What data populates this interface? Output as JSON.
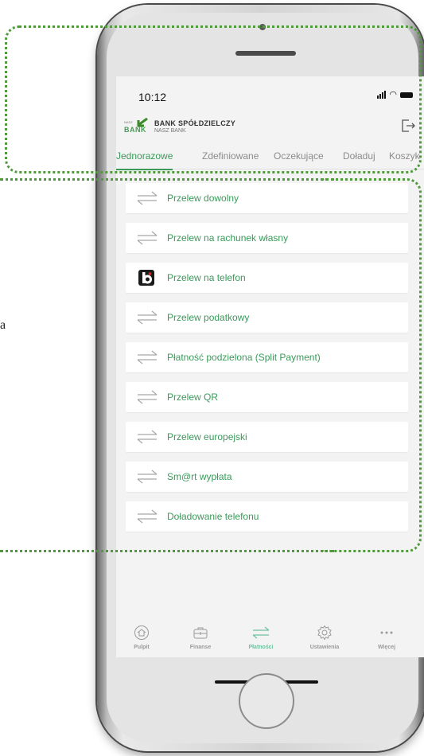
{
  "status": {
    "time": "10:12"
  },
  "brand": {
    "logo_small": "NASZ",
    "logo_word": "BANK",
    "name": "BANK SPÓŁDZIELCZY",
    "subtitle": "NASZ BANK"
  },
  "tabs": [
    {
      "label": "Jednorazowe",
      "active": true
    },
    {
      "label": "Zdefiniowane",
      "active": false
    },
    {
      "label": "Oczekujące",
      "active": false
    },
    {
      "label": "Doładuj",
      "active": false
    },
    {
      "label": "Koszyk",
      "active": false
    }
  ],
  "payments": [
    {
      "label": "Przelew dowolny",
      "icon": "transfer-arrows-icon"
    },
    {
      "label": "Przelew na rachunek własny",
      "icon": "transfer-arrows-icon"
    },
    {
      "label": "Przelew na telefon",
      "icon": "blik-icon"
    },
    {
      "label": "Przelew podatkowy",
      "icon": "transfer-arrows-icon"
    },
    {
      "label": "Płatność podzielona (Split Payment)",
      "icon": "transfer-arrows-icon"
    },
    {
      "label": "Przelew QR",
      "icon": "transfer-arrows-icon"
    },
    {
      "label": "Przelew europejski",
      "icon": "transfer-arrows-icon"
    },
    {
      "label": "Sm@rt wypłata",
      "icon": "transfer-arrows-icon"
    },
    {
      "label": "Doładowanie telefonu",
      "icon": "transfer-arrows-icon"
    }
  ],
  "nav": [
    {
      "label": "Pulpit",
      "icon": "home-icon",
      "active": false
    },
    {
      "label": "Finanse",
      "icon": "briefcase-icon",
      "active": false
    },
    {
      "label": "Płatności",
      "icon": "transfer-arrows-icon",
      "active": true
    },
    {
      "label": "Ustawienia",
      "icon": "gear-icon",
      "active": false
    },
    {
      "label": "Więcej",
      "icon": "more-dots-icon",
      "active": false
    }
  ],
  "side_text": "a",
  "colors": {
    "accent": "#3a9a5a",
    "highlight_frame": "#4f9a3a",
    "nav_active": "#6ec2a0"
  }
}
